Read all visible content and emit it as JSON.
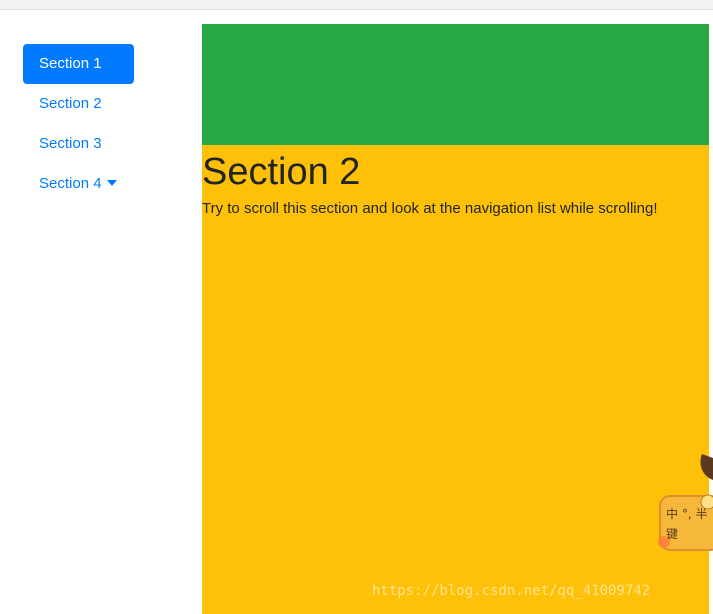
{
  "nav": {
    "items": [
      {
        "label": "Section 1",
        "active": true
      },
      {
        "label": "Section 2",
        "active": false
      },
      {
        "label": "Section 3",
        "active": false
      },
      {
        "label": "Section 4",
        "active": false,
        "dropdown": true
      }
    ]
  },
  "main": {
    "section2": {
      "title": "Section 2",
      "text": "Try to scroll this section and look at the navigation list while scrolling!"
    }
  },
  "colors": {
    "primary": "#007bff",
    "section1_bg": "#28a745",
    "section2_bg": "#ffc107"
  },
  "watermark": {
    "text": "https://blog.csdn.net/qq_41009742"
  },
  "mascot": {
    "text": "中 °, 半 键"
  }
}
